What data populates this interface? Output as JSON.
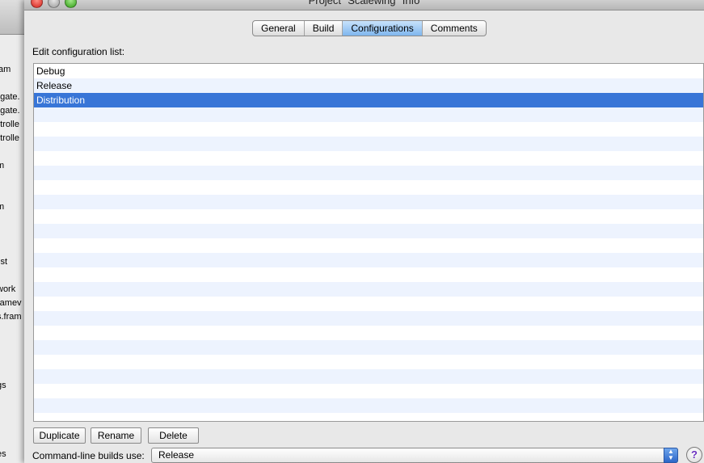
{
  "window": {
    "title": "Project \"Scalewing\" Info"
  },
  "tabs": [
    {
      "label": "General"
    },
    {
      "label": "Build"
    },
    {
      "label": "Configurations"
    },
    {
      "label": "Comments"
    }
  ],
  "edit_label": "Edit configuration list:",
  "configurations": [
    "Debug",
    "Release",
    "Distribution"
  ],
  "selected_configuration": "Distribution",
  "buttons": {
    "duplicate": "Duplicate",
    "rename": "Rename",
    "delete": "Delete"
  },
  "cmdline": {
    "label": "Command-line builds use:",
    "value": "Release"
  },
  "help": {
    "glyph": "?"
  },
  "background_window": {
    "items": [
      "am",
      "egate.",
      "egate.",
      "ntrolle",
      "ntrolle",
      "m",
      "m",
      "ist",
      "work",
      "ramev",
      "s.fram",
      "gs",
      "es"
    ]
  },
  "colors": {
    "selection": "#3875d7",
    "alt_row": "#edf3fe",
    "active_tab": "#7fb6ee"
  }
}
